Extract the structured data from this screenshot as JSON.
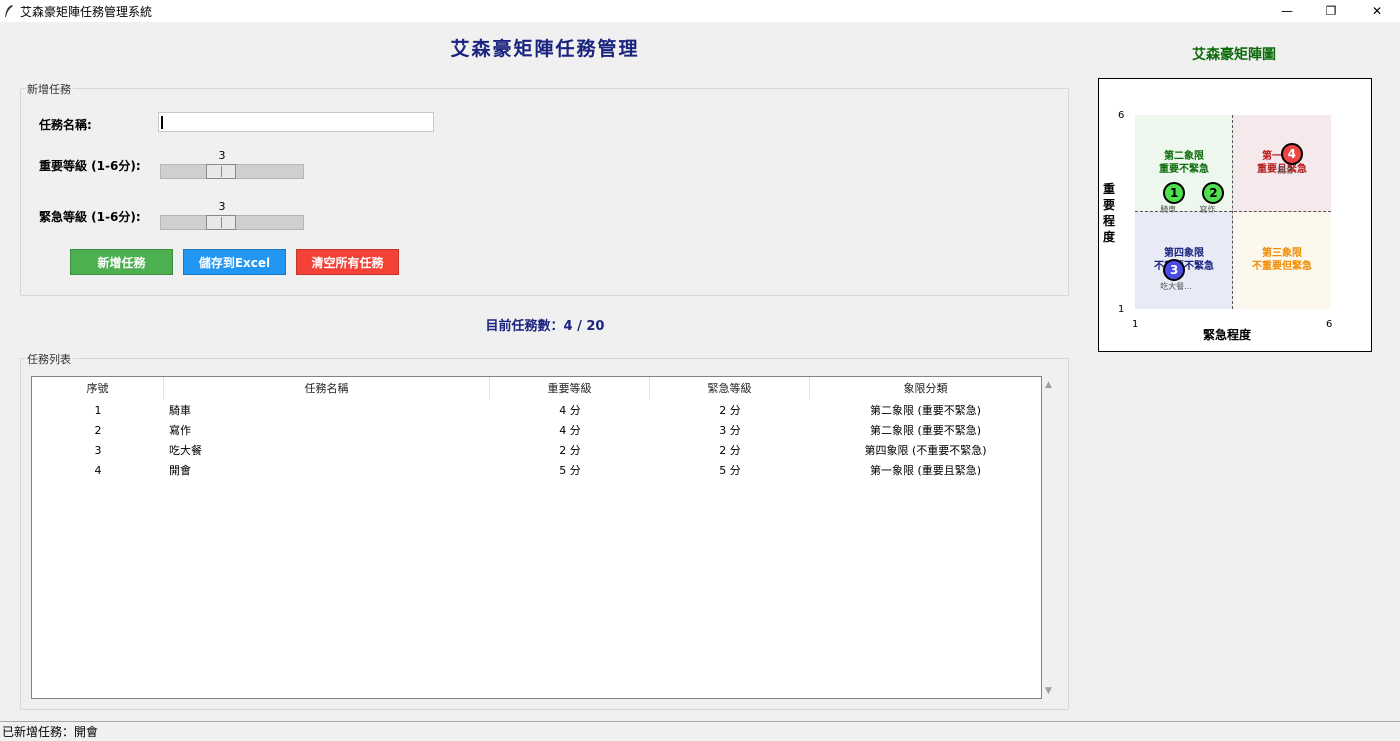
{
  "window": {
    "title": "艾森豪矩陣任務管理系統",
    "min_glyph": "—",
    "max_glyph": "❐",
    "close_glyph": "✕"
  },
  "header": {
    "title": "艾森豪矩陣任務管理"
  },
  "add_task": {
    "group_label": "新增任務",
    "name_label": "任務名稱:",
    "name_value": "",
    "importance_label": "重要等級 (1-6分):",
    "importance_value": "3",
    "importance_level": 3,
    "urgency_label": "緊急等級 (1-6分):",
    "urgency_value": "3",
    "urgency_level": 3,
    "scale_range": [
      1,
      6
    ]
  },
  "buttons": {
    "add": "新增任務",
    "save": "儲存到Excel",
    "clear": "清空所有任務"
  },
  "colors": {
    "add_button": "#4caf50",
    "save_button": "#2196f3",
    "clear_button": "#f44336",
    "title": "#1a237e",
    "q1": "#b71c1c",
    "q2": "#0b6b0b",
    "q3": "#ef8c00",
    "q4": "#1a237e"
  },
  "task_count": "目前任務數：4 / 20",
  "task_list": {
    "group_label": "任務列表",
    "columns": [
      "序號",
      "任務名稱",
      "重要等級",
      "緊急等級",
      "象限分類"
    ],
    "rows": [
      [
        "1",
        "騎車",
        "4 分",
        "2 分",
        "第二象限 (重要不緊急)"
      ],
      [
        "2",
        "寫作",
        "4 分",
        "3 分",
        "第二象限 (重要不緊急)"
      ],
      [
        "3",
        "吃大餐",
        "2 分",
        "2 分",
        "第四象限 (不重要不緊急)"
      ],
      [
        "4",
        "開會",
        "5 分",
        "5 分",
        "第一象限 (重要且緊急)"
      ]
    ]
  },
  "status": "已新增任務：開會",
  "matrix": {
    "title": "艾森豪矩陣圖",
    "x_label": "緊急程度",
    "y_label": "重要程度",
    "x_min": "1",
    "x_max": "6",
    "y_min": "1",
    "y_max": "6",
    "q1": "第一象限\n重要且緊急",
    "q2": "第二象限\n重要不緊急",
    "q3": "第三象限\n不重要但緊急",
    "q4": "第四象限\n不重要不緊急",
    "points": [
      {
        "id": "1",
        "label": "騎車...",
        "urgency": 2,
        "importance": 4
      },
      {
        "id": "2",
        "label": "寫作...",
        "urgency": 3,
        "importance": 4
      },
      {
        "id": "3",
        "label": "吃大餐...",
        "urgency": 2,
        "importance": 2
      },
      {
        "id": "4",
        "label": "開會...",
        "urgency": 5,
        "importance": 5
      }
    ]
  }
}
